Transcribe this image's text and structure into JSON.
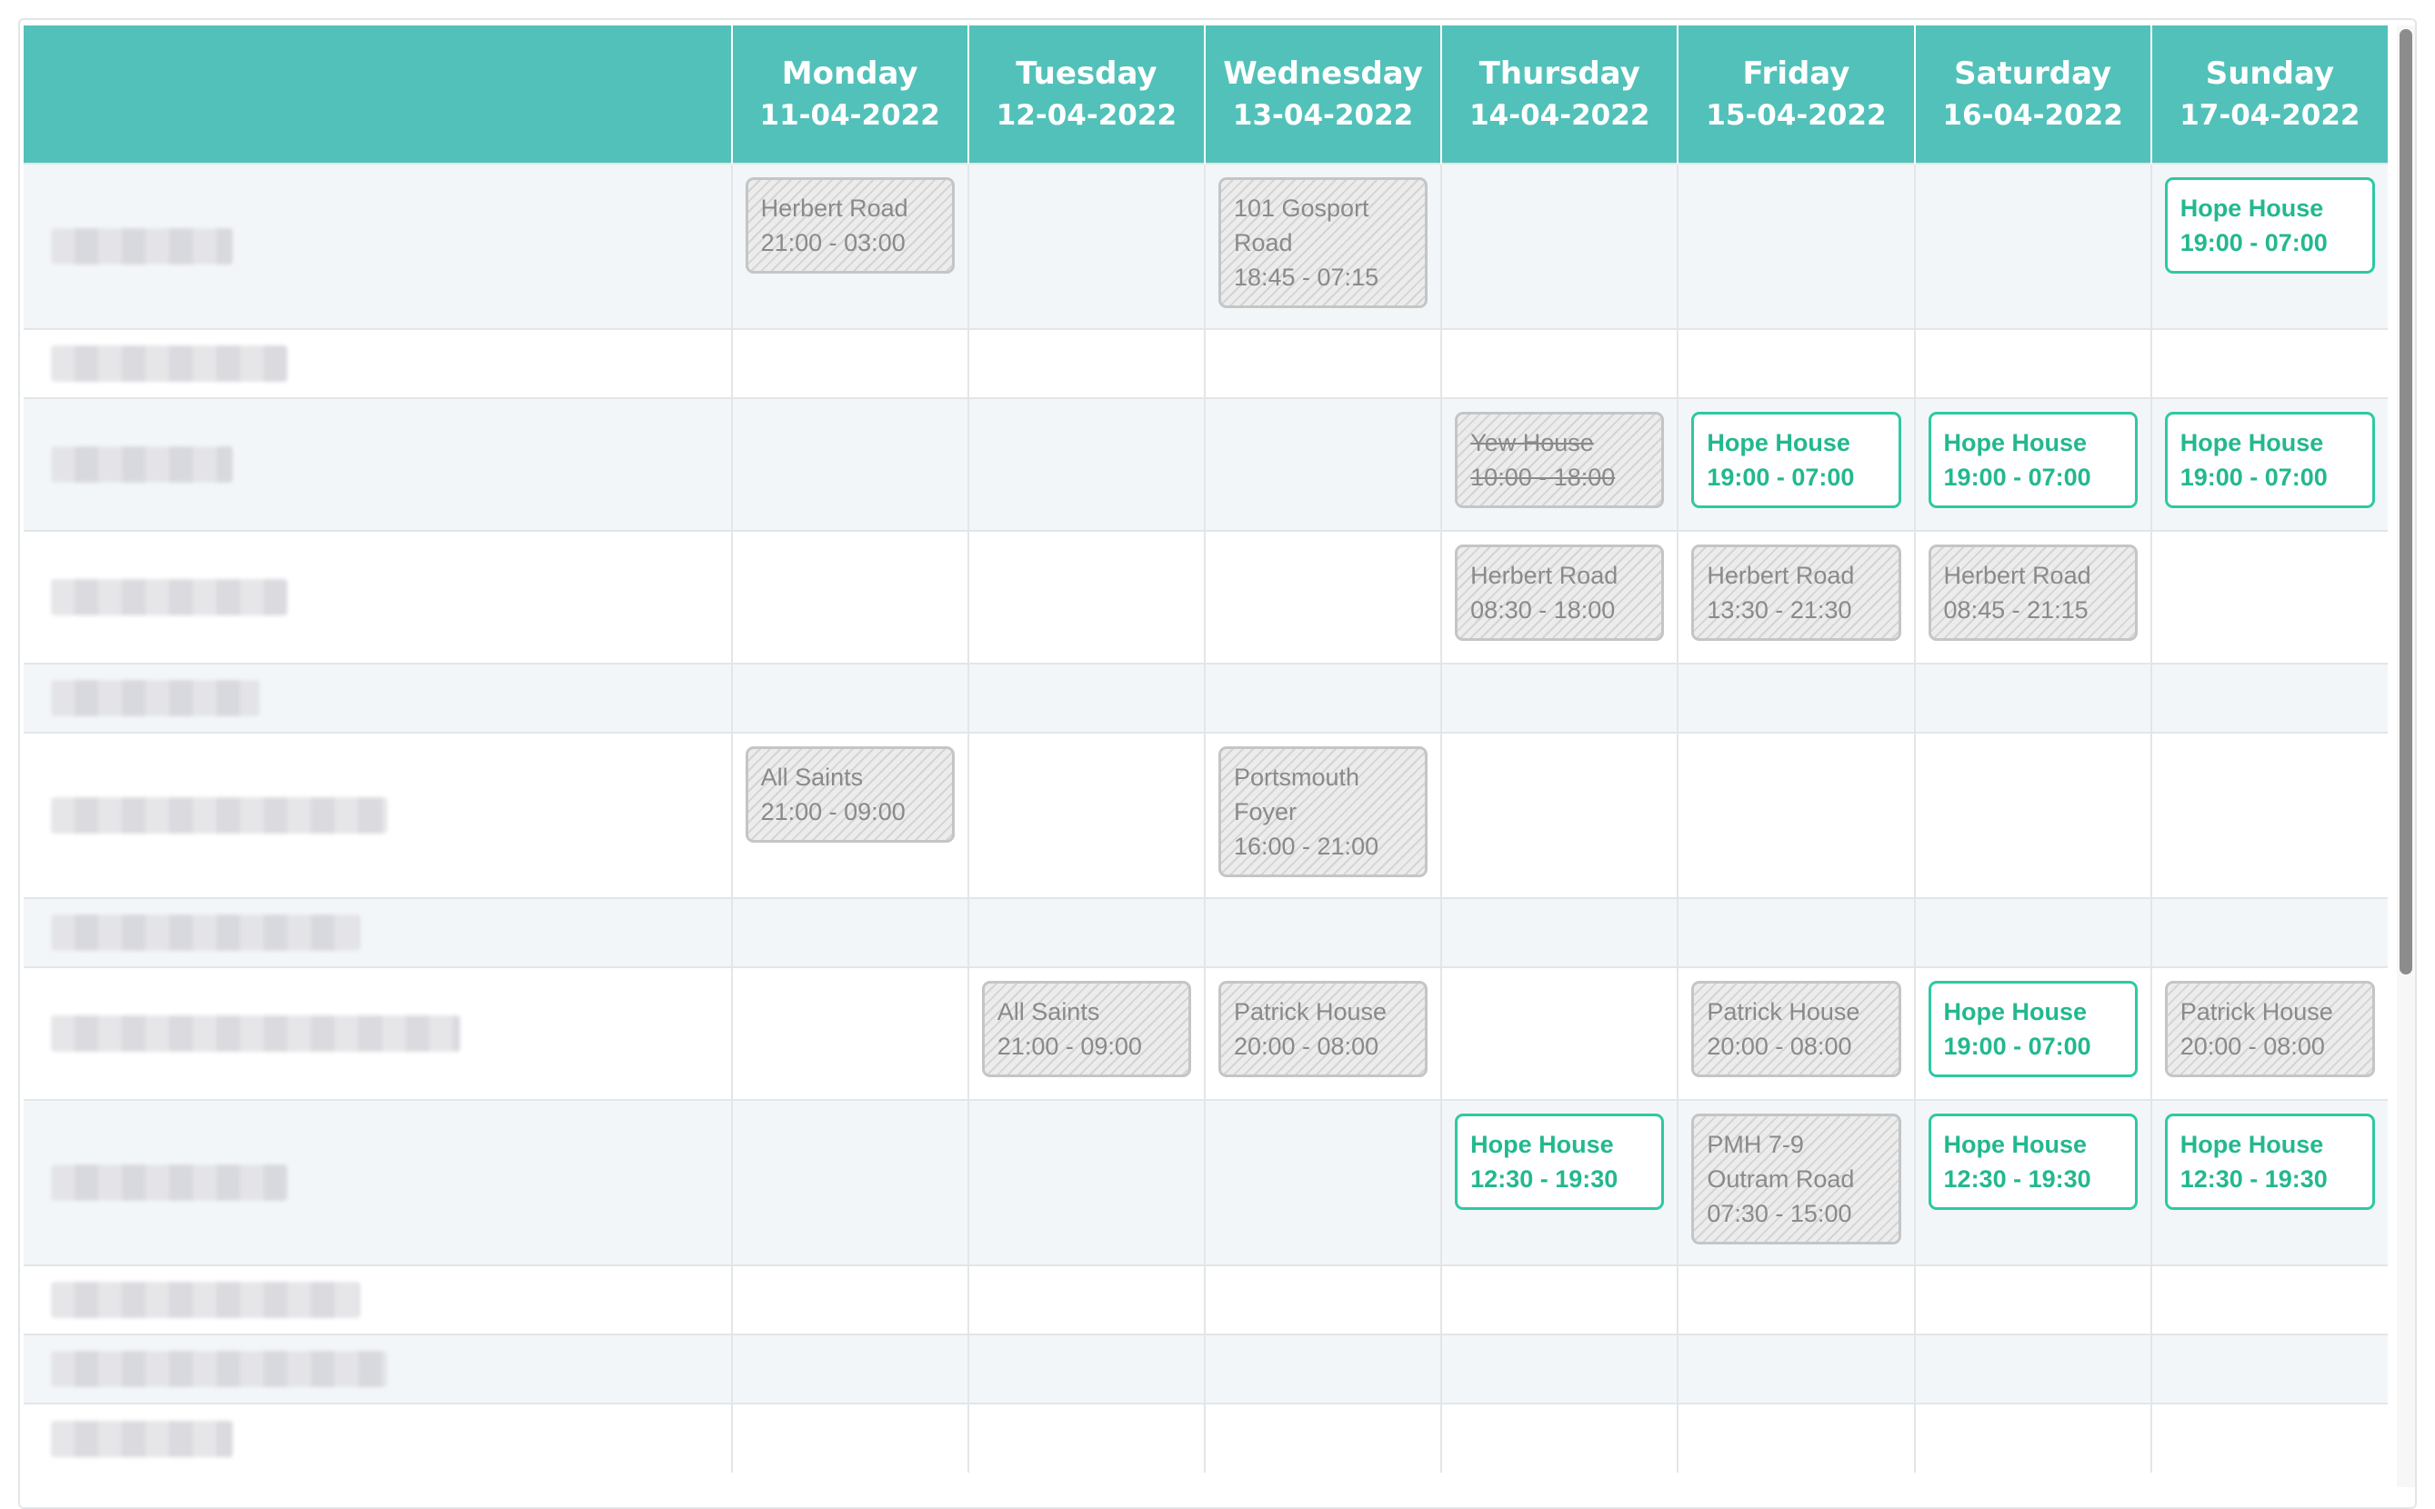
{
  "days": [
    {
      "name": "Monday",
      "date": "11-04-2022"
    },
    {
      "name": "Tuesday",
      "date": "12-04-2022"
    },
    {
      "name": "Wednesday",
      "date": "13-04-2022"
    },
    {
      "name": "Thursday",
      "date": "14-04-2022"
    },
    {
      "name": "Friday",
      "date": "15-04-2022"
    },
    {
      "name": "Saturday",
      "date": "16-04-2022"
    },
    {
      "name": "Sunday",
      "date": "17-04-2022"
    }
  ],
  "colors": {
    "header": "#52c1b9",
    "open_shift": "#2dc9a2",
    "past_shift": "#c3c5c7"
  },
  "rows": [
    {
      "shifts": [
        {
          "day": 0,
          "lines": [
            "Herbert Road",
            "21:00 - 03:00"
          ],
          "status": "past"
        },
        {
          "day": 2,
          "lines": [
            "101 Gosport",
            "Road",
            "18:45 - 07:15"
          ],
          "status": "past"
        },
        {
          "day": 6,
          "lines": [
            "Hope House",
            "19:00 - 07:00"
          ],
          "status": "open"
        }
      ]
    },
    {
      "shifts": []
    },
    {
      "shifts": [
        {
          "day": 3,
          "lines": [
            "Yew House",
            "10:00 - 18:00"
          ],
          "status": "cancelled"
        },
        {
          "day": 4,
          "lines": [
            "Hope House",
            "19:00 - 07:00"
          ],
          "status": "open"
        },
        {
          "day": 5,
          "lines": [
            "Hope House",
            "19:00 - 07:00"
          ],
          "status": "open"
        },
        {
          "day": 6,
          "lines": [
            "Hope House",
            "19:00 - 07:00"
          ],
          "status": "open"
        }
      ]
    },
    {
      "shifts": [
        {
          "day": 3,
          "lines": [
            "Herbert Road",
            "08:30 - 18:00"
          ],
          "status": "past"
        },
        {
          "day": 4,
          "lines": [
            "Herbert Road",
            "13:30 - 21:30"
          ],
          "status": "past"
        },
        {
          "day": 5,
          "lines": [
            "Herbert Road",
            "08:45 - 21:15"
          ],
          "status": "past"
        }
      ]
    },
    {
      "shifts": []
    },
    {
      "shifts": [
        {
          "day": 0,
          "lines": [
            "All Saints",
            "21:00 - 09:00"
          ],
          "status": "past"
        },
        {
          "day": 2,
          "lines": [
            "Portsmouth",
            "Foyer",
            "16:00 - 21:00"
          ],
          "status": "past"
        }
      ]
    },
    {
      "shifts": []
    },
    {
      "shifts": [
        {
          "day": 1,
          "lines": [
            "All Saints",
            "21:00 - 09:00"
          ],
          "status": "past"
        },
        {
          "day": 2,
          "lines": [
            "Patrick House",
            "20:00 - 08:00"
          ],
          "status": "past"
        },
        {
          "day": 4,
          "lines": [
            "Patrick House",
            "20:00 - 08:00"
          ],
          "status": "past"
        },
        {
          "day": 5,
          "lines": [
            "Hope House",
            "19:00 - 07:00"
          ],
          "status": "open"
        },
        {
          "day": 6,
          "lines": [
            "Patrick House",
            "20:00 - 08:00"
          ],
          "status": "past"
        }
      ]
    },
    {
      "shifts": [
        {
          "day": 3,
          "lines": [
            "Hope House",
            "12:30 - 19:30"
          ],
          "status": "open"
        },
        {
          "day": 4,
          "lines": [
            "PMH 7-9",
            "Outram Road",
            "07:30 - 15:00"
          ],
          "status": "past"
        },
        {
          "day": 5,
          "lines": [
            "Hope House",
            "12:30 - 19:30"
          ],
          "status": "open"
        },
        {
          "day": 6,
          "lines": [
            "Hope House",
            "12:30 - 19:30"
          ],
          "status": "open"
        }
      ]
    },
    {
      "shifts": []
    },
    {
      "shifts": []
    },
    {
      "shifts": []
    }
  ]
}
